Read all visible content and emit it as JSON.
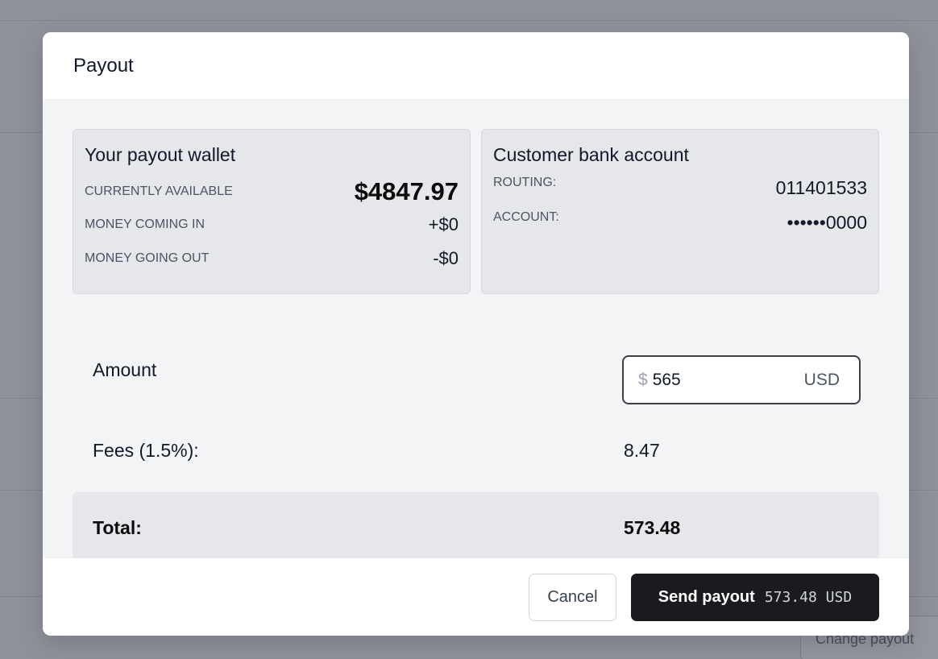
{
  "background": {
    "ghost_button_label": "Change payout"
  },
  "modal": {
    "title": "Payout"
  },
  "wallet": {
    "title": "Your payout wallet",
    "rows": [
      {
        "label": "CURRENTLY AVAILABLE",
        "value": "$4847.97"
      },
      {
        "label": "MONEY COMING IN",
        "value": "+$0"
      },
      {
        "label": "MONEY GOING OUT",
        "value": "-$0"
      }
    ]
  },
  "bank": {
    "title": "Customer bank account",
    "routing_label": "ROUTING:",
    "routing_value": "011401533",
    "account_label": "ACCOUNT:",
    "account_value": "••••••0000"
  },
  "amount": {
    "label": "Amount",
    "currency_symbol": "$",
    "value": "565",
    "currency_code": "USD"
  },
  "fees": {
    "label": "Fees (1.5%):",
    "value": "8.47"
  },
  "total": {
    "label": "Total:",
    "value": "573.48"
  },
  "footer": {
    "cancel_label": "Cancel",
    "send_label": "Send payout",
    "send_amount": "573.48 USD"
  },
  "colors": {
    "primary_button": "#1a1b1e",
    "overlay": "#5b606c"
  }
}
